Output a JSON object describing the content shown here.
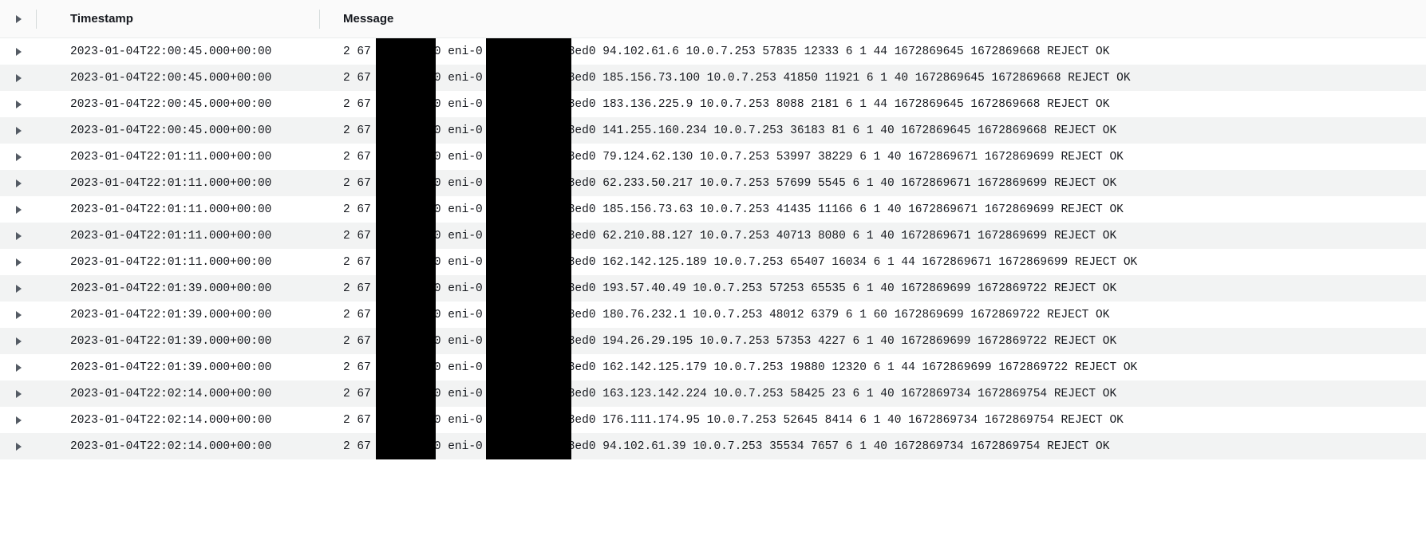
{
  "headers": {
    "timestamp": "Timestamp",
    "message": "Message"
  },
  "rows": [
    {
      "timestamp": "2023-01-04T22:00:45.000+00:00",
      "msg_prefix": "2 67",
      "msg_mid": "0 eni-0",
      "msg_suffix": "8ed0 94.102.61.6 10.0.7.253 57835 12333 6 1 44 1672869645 1672869668 REJECT OK"
    },
    {
      "timestamp": "2023-01-04T22:00:45.000+00:00",
      "msg_prefix": "2 67",
      "msg_mid": "0 eni-0",
      "msg_suffix": "8ed0 185.156.73.100 10.0.7.253 41850 11921 6 1 40 1672869645 1672869668 REJECT OK"
    },
    {
      "timestamp": "2023-01-04T22:00:45.000+00:00",
      "msg_prefix": "2 67",
      "msg_mid": "0 eni-0",
      "msg_suffix": "8ed0 183.136.225.9 10.0.7.253 8088 2181 6 1 44 1672869645 1672869668 REJECT OK"
    },
    {
      "timestamp": "2023-01-04T22:00:45.000+00:00",
      "msg_prefix": "2 67",
      "msg_mid": "0 eni-0",
      "msg_suffix": "8ed0 141.255.160.234 10.0.7.253 36183 81 6 1 40 1672869645 1672869668 REJECT OK"
    },
    {
      "timestamp": "2023-01-04T22:01:11.000+00:00",
      "msg_prefix": "2 67",
      "msg_mid": "0 eni-0",
      "msg_suffix": "8ed0 79.124.62.130 10.0.7.253 53997 38229 6 1 40 1672869671 1672869699 REJECT OK"
    },
    {
      "timestamp": "2023-01-04T22:01:11.000+00:00",
      "msg_prefix": "2 67",
      "msg_mid": "0 eni-0",
      "msg_suffix": "8ed0 62.233.50.217 10.0.7.253 57699 5545 6 1 40 1672869671 1672869699 REJECT OK"
    },
    {
      "timestamp": "2023-01-04T22:01:11.000+00:00",
      "msg_prefix": "2 67",
      "msg_mid": "0 eni-0",
      "msg_suffix": "8ed0 185.156.73.63 10.0.7.253 41435 11166 6 1 40 1672869671 1672869699 REJECT OK"
    },
    {
      "timestamp": "2023-01-04T22:01:11.000+00:00",
      "msg_prefix": "2 67",
      "msg_mid": "0 eni-0",
      "msg_suffix": "8ed0 62.210.88.127 10.0.7.253 40713 8080 6 1 40 1672869671 1672869699 REJECT OK"
    },
    {
      "timestamp": "2023-01-04T22:01:11.000+00:00",
      "msg_prefix": "2 67",
      "msg_mid": "0 eni-0",
      "msg_suffix": "8ed0 162.142.125.189 10.0.7.253 65407 16034 6 1 44 1672869671 1672869699 REJECT OK"
    },
    {
      "timestamp": "2023-01-04T22:01:39.000+00:00",
      "msg_prefix": "2 67",
      "msg_mid": "0 eni-0",
      "msg_suffix": "8ed0 193.57.40.49 10.0.7.253 57253 65535 6 1 40 1672869699 1672869722 REJECT OK"
    },
    {
      "timestamp": "2023-01-04T22:01:39.000+00:00",
      "msg_prefix": "2 67",
      "msg_mid": "0 eni-0",
      "msg_suffix": "8ed0 180.76.232.1 10.0.7.253 48012 6379 6 1 60 1672869699 1672869722 REJECT OK"
    },
    {
      "timestamp": "2023-01-04T22:01:39.000+00:00",
      "msg_prefix": "2 67",
      "msg_mid": "0 eni-0",
      "msg_suffix": "8ed0 194.26.29.195 10.0.7.253 57353 4227 6 1 40 1672869699 1672869722 REJECT OK"
    },
    {
      "timestamp": "2023-01-04T22:01:39.000+00:00",
      "msg_prefix": "2 67",
      "msg_mid": "0 eni-0",
      "msg_suffix": "8ed0 162.142.125.179 10.0.7.253 19880 12320 6 1 44 1672869699 1672869722 REJECT OK"
    },
    {
      "timestamp": "2023-01-04T22:02:14.000+00:00",
      "msg_prefix": "2 67",
      "msg_mid": "0 eni-0",
      "msg_suffix": "8ed0 163.123.142.224 10.0.7.253 58425 23 6 1 40 1672869734 1672869754 REJECT OK"
    },
    {
      "timestamp": "2023-01-04T22:02:14.000+00:00",
      "msg_prefix": "2 67",
      "msg_mid": "0 eni-0",
      "msg_suffix": "8ed0 176.111.174.95 10.0.7.253 52645 8414 6 1 40 1672869734 1672869754 REJECT OK"
    },
    {
      "timestamp": "2023-01-04T22:02:14.000+00:00",
      "msg_prefix": "2 67",
      "msg_mid": "0 eni-0",
      "msg_suffix": "8ed0 94.102.61.39 10.0.7.253 35534 7657 6 1 40 1672869734 1672869754 REJECT OK"
    }
  ]
}
